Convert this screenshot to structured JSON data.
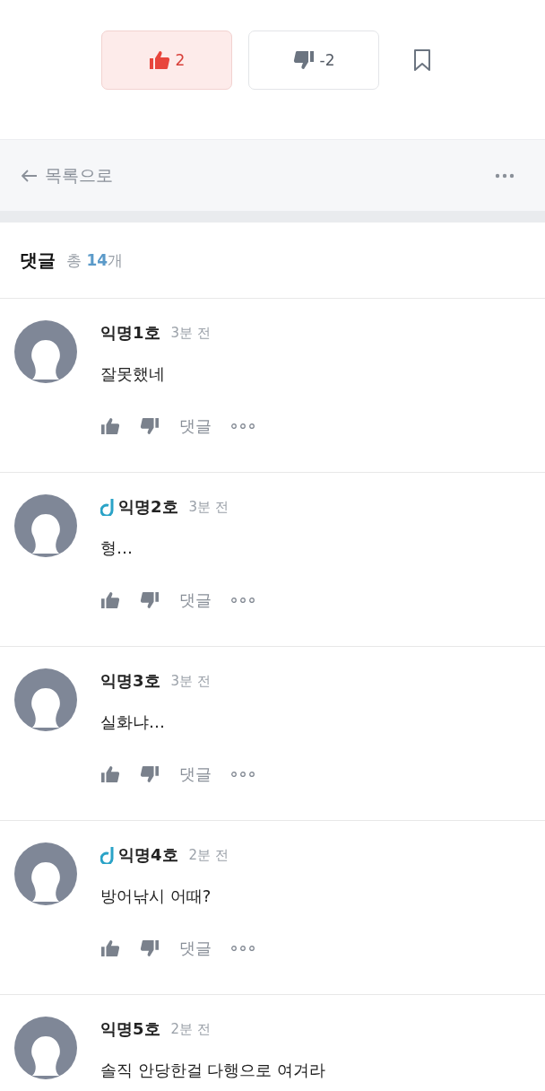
{
  "votes": [
    {
      "kind": "like",
      "count": "2",
      "selected": true
    },
    {
      "kind": "dislike",
      "count": "-2",
      "selected": false
    }
  ],
  "nav": {
    "back_label": "목록으로"
  },
  "comments_header": {
    "title": "댓글",
    "total_prefix": "총",
    "total_count": "14",
    "total_suffix": "개"
  },
  "comments": [
    {
      "name": "익명1호",
      "badge": false,
      "time": "3분 전",
      "body": "잘못했네",
      "reply_label": "댓글"
    },
    {
      "name": "익명2호",
      "badge": true,
      "time": "3분 전",
      "body": "형…",
      "reply_label": "댓글"
    },
    {
      "name": "익명3호",
      "badge": false,
      "time": "3분 전",
      "body": "실화냐…",
      "reply_label": "댓글"
    },
    {
      "name": "익명4호",
      "badge": true,
      "time": "2분 전",
      "body": "방어낚시 어때?",
      "reply_label": "댓글"
    },
    {
      "name": "익명5호",
      "badge": false,
      "time": "2분 전",
      "body": "솔직 안당한걸 다행으로 여겨라"
    }
  ]
}
